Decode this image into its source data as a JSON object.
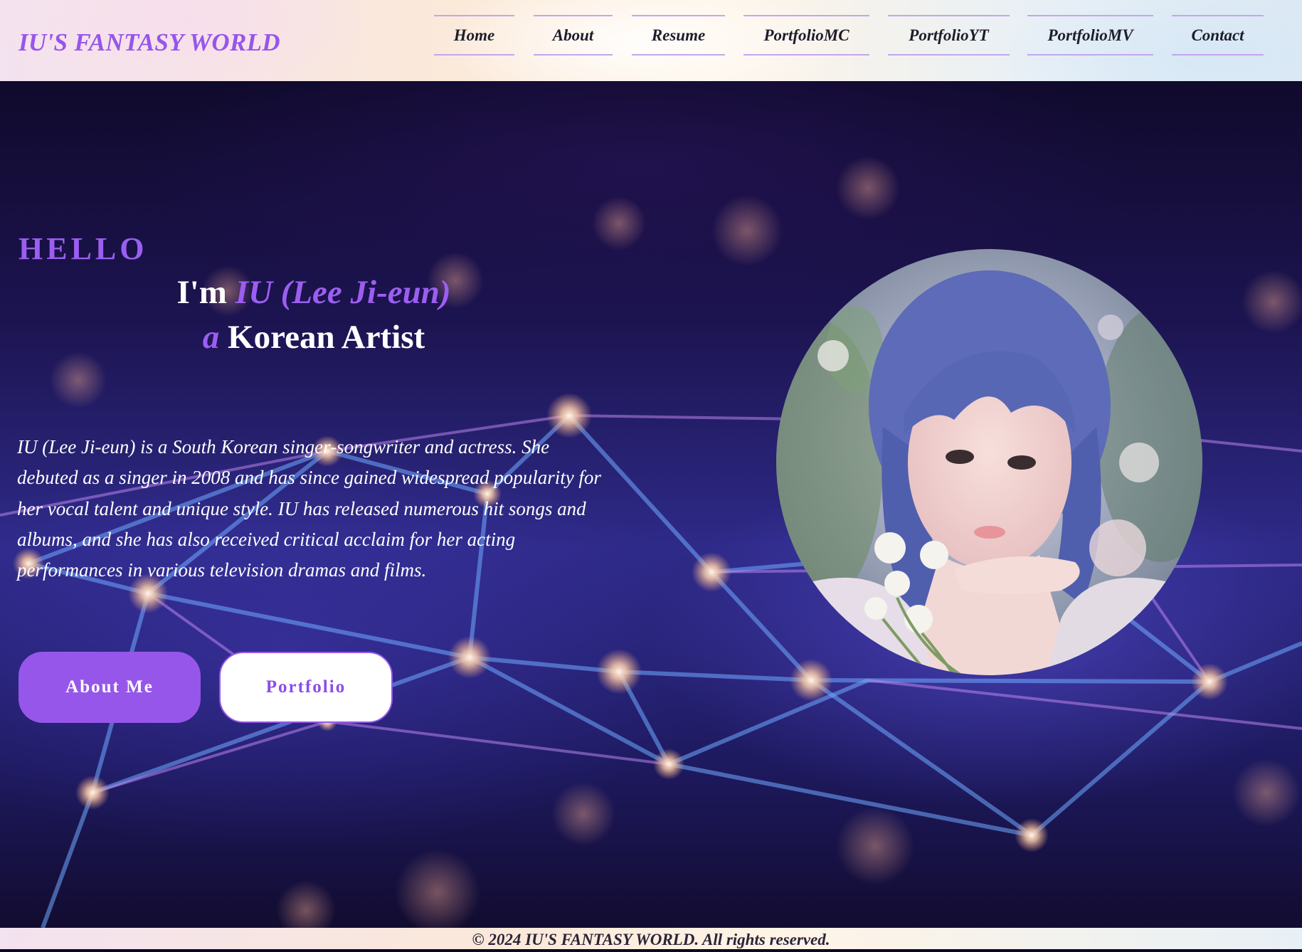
{
  "brand": {
    "title": "IU'S FANTASY WORLD"
  },
  "nav": {
    "items": [
      {
        "label": "Home"
      },
      {
        "label": "About"
      },
      {
        "label": "Resume"
      },
      {
        "label": "PortfolioMC"
      },
      {
        "label": "PortfolioYT"
      },
      {
        "label": "PortfolioMV"
      },
      {
        "label": "Contact"
      }
    ]
  },
  "hero": {
    "greeting": "HELLO",
    "line1_prefix": "I'm",
    "name": "IU (Lee Ji-eun)",
    "line2_article": "a",
    "line2_role": "Korean Artist",
    "description": "IU (Lee Ji-eun) is a South Korean singer-songwriter and actress. She debuted as a singer in 2008 and has since gained widespread popularity for her vocal talent and unique style. IU has released numerous hit songs and albums, and she has also received critical acclaim for her acting performances in various television dramas and films.",
    "buttons": {
      "primary": "About Me",
      "secondary": "Portfolio"
    },
    "photo_alt": "portrait-photo"
  },
  "footer": {
    "text": "© 2024 IU'S FANTASY WORLD. All rights reserved."
  },
  "colors": {
    "accent": "#9656ea",
    "nav_border": "#c2a6ee",
    "hero_text": "#ffffff",
    "hero_bg": "#1c1450"
  }
}
